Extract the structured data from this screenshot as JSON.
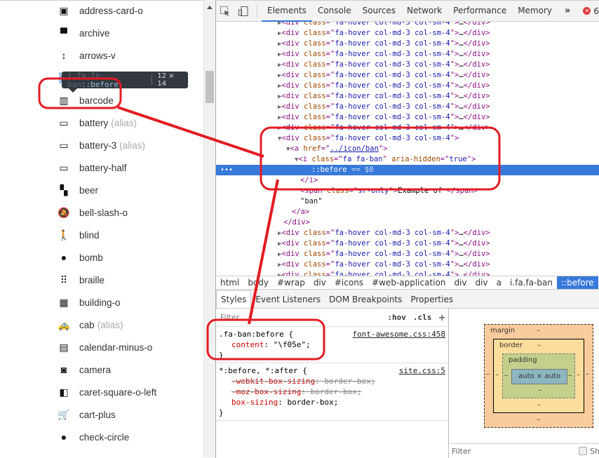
{
  "page": {
    "icons": [
      {
        "name": "address-card-o",
        "alias": false,
        "glyph": "▣"
      },
      {
        "name": "archive",
        "alias": false,
        "glyph": "▀"
      },
      {
        "name": "arrows-v",
        "alias": false,
        "glyph": "↕"
      },
      {
        "name": "ban",
        "alias": false,
        "glyph": "⊘"
      },
      {
        "name": "barcode",
        "alias": false,
        "glyph": "▥"
      },
      {
        "name": "battery",
        "alias": true,
        "glyph": "▭"
      },
      {
        "name": "battery-3",
        "alias": true,
        "glyph": "▭"
      },
      {
        "name": "battery-half",
        "alias": false,
        "glyph": "▭"
      },
      {
        "name": "beer",
        "alias": false,
        "glyph": "▚"
      },
      {
        "name": "bell-slash-o",
        "alias": false,
        "glyph": "🔕"
      },
      {
        "name": "blind",
        "alias": false,
        "glyph": "🚶"
      },
      {
        "name": "bomb",
        "alias": false,
        "glyph": "●"
      },
      {
        "name": "braille",
        "alias": false,
        "glyph": "⠿"
      },
      {
        "name": "building-o",
        "alias": false,
        "glyph": "▦"
      },
      {
        "name": "cab",
        "alias": true,
        "glyph": "🚕"
      },
      {
        "name": "calendar-minus-o",
        "alias": false,
        "glyph": "▤"
      },
      {
        "name": "camera",
        "alias": false,
        "glyph": "◙"
      },
      {
        "name": "caret-square-o-left",
        "alias": false,
        "glyph": "◧"
      },
      {
        "name": "cart-plus",
        "alias": false,
        "glyph": "🛒"
      },
      {
        "name": "check-circle",
        "alias": false,
        "glyph": "●"
      }
    ],
    "alias_label": "(alias)",
    "tooltip": {
      "selector_prefix": "i.fa.fa-ban",
      "selector_pseudo": "::before",
      "size": "12 × 14"
    }
  },
  "devtools": {
    "tabs": [
      "Elements",
      "Console",
      "Sources",
      "Network",
      "Performance",
      "Memory"
    ],
    "active_tab": "Elements",
    "more_tabs": "»",
    "error_count": "6",
    "dom": {
      "collapsed_div": {
        "tag": "div",
        "attr": "class",
        "value": "fa-hover col-md-3 col-sm-4"
      },
      "expanded": {
        "div_open": "<div class=\"fa-hover col-md-3 col-sm-4\">",
        "a_href": "../icon/ban",
        "i_class": "fa fa-ban",
        "i_aria": "true",
        "pseudo": "::before",
        "pseudo_ref": "== $0",
        "i_close": "</i>",
        "span_line": "<span class=\"sr-only\">Example of </span>",
        "text": "\"ban\"",
        "a_close": "</a>",
        "div_close": "</div>"
      }
    },
    "breadcrumbs": [
      "html",
      "body",
      "#wrap",
      "div",
      "#icons",
      "#web-application",
      "div",
      "div",
      "a",
      "i.fa.fa-ban",
      "::before"
    ],
    "subtabs": [
      "Styles",
      "Event Listeners",
      "DOM Breakpoints",
      "Properties"
    ],
    "styles": {
      "filter_placeholder": "Filter",
      "hov": ":hov",
      "cls": ".cls",
      "plus": "+",
      "rules": [
        {
          "selector": ".fa-ban:before {",
          "source": "font-awesome.css:458",
          "props": [
            {
              "name": "content",
              "value": "\"\\f05e\";",
              "struck": false
            }
          ],
          "close": "}"
        },
        {
          "selector": "*:before, *:after {",
          "source": "site.css:5",
          "props": [
            {
              "name": "-webkit-box-sizing",
              "value": "border-box;",
              "struck": true
            },
            {
              "name": "-moz-box-sizing",
              "value": "border-box;",
              "struck": true
            },
            {
              "name": "box-sizing",
              "value": "border-box;",
              "struck": false
            }
          ],
          "close": "}"
        }
      ]
    },
    "box_model": {
      "margin": "margin",
      "border": "border",
      "padding": "padding",
      "content": "auto × auto",
      "dash": "–",
      "filter": "Filter",
      "show_all": "Sh"
    }
  },
  "colors": {
    "accent": "#3879d9",
    "annotation": "#e31b23",
    "error": "#e0393e"
  }
}
